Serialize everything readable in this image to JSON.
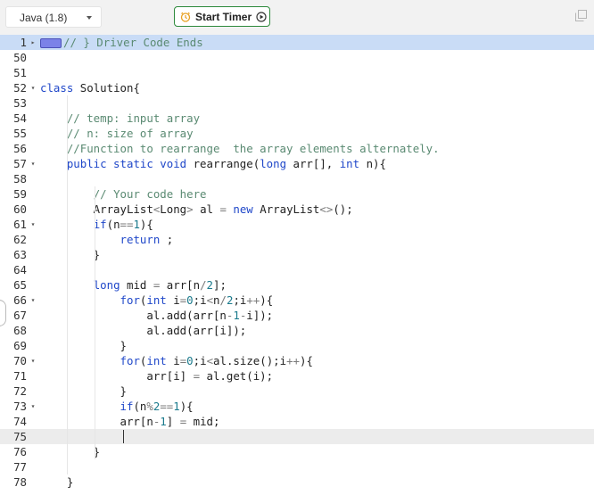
{
  "toolbar": {
    "language": "Java (1.8)",
    "timer_label": "Start Timer",
    "accent": "#2e8a3c"
  },
  "editor": {
    "lines": [
      {
        "num": "1",
        "fold": "right",
        "hl": "blue",
        "badge": true,
        "tokens": [
          [
            "c",
            "// } Driver Code Ends"
          ]
        ]
      },
      {
        "num": "50",
        "tokens": []
      },
      {
        "num": "51",
        "tokens": []
      },
      {
        "num": "52",
        "fold": "down",
        "tokens": [
          [
            "k",
            "class"
          ],
          [
            "t",
            " Solution{"
          ]
        ]
      },
      {
        "num": "53",
        "tokens": []
      },
      {
        "num": "54",
        "tokens": [
          [
            "t",
            "    "
          ],
          [
            "c",
            "// temp: input array"
          ]
        ]
      },
      {
        "num": "55",
        "tokens": [
          [
            "t",
            "    "
          ],
          [
            "c",
            "// n: size of array"
          ]
        ]
      },
      {
        "num": "56",
        "tokens": [
          [
            "t",
            "    "
          ],
          [
            "c",
            "//Function to rearrange  the array elements alternately."
          ]
        ]
      },
      {
        "num": "57",
        "fold": "down",
        "tokens": [
          [
            "t",
            "    "
          ],
          [
            "k",
            "public static void"
          ],
          [
            "t",
            " rearrange("
          ],
          [
            "k",
            "long"
          ],
          [
            "t",
            " arr[], "
          ],
          [
            "k",
            "int"
          ],
          [
            "t",
            " n){"
          ]
        ]
      },
      {
        "num": "58",
        "tokens": []
      },
      {
        "num": "59",
        "tokens": [
          [
            "t",
            "        "
          ],
          [
            "c",
            "// Your code here"
          ]
        ]
      },
      {
        "num": "60",
        "tokens": [
          [
            "t",
            "        ArrayList"
          ],
          [
            "o",
            "<"
          ],
          [
            "t",
            "Long"
          ],
          [
            "o",
            ">"
          ],
          [
            "t",
            " al "
          ],
          [
            "o",
            "="
          ],
          [
            "t",
            " "
          ],
          [
            "k",
            "new"
          ],
          [
            "t",
            " ArrayList"
          ],
          [
            "o",
            "<>"
          ],
          [
            "t",
            "();"
          ]
        ]
      },
      {
        "num": "61",
        "fold": "down",
        "tokens": [
          [
            "t",
            "        "
          ],
          [
            "k",
            "if"
          ],
          [
            "t",
            "(n"
          ],
          [
            "o",
            "=="
          ],
          [
            "n",
            "1"
          ],
          [
            "t",
            "){"
          ]
        ]
      },
      {
        "num": "62",
        "tokens": [
          [
            "t",
            "            "
          ],
          [
            "k",
            "return"
          ],
          [
            "t",
            " ;"
          ]
        ]
      },
      {
        "num": "63",
        "tokens": [
          [
            "t",
            "        }"
          ]
        ]
      },
      {
        "num": "64",
        "tokens": []
      },
      {
        "num": "65",
        "tokens": [
          [
            "t",
            "        "
          ],
          [
            "k",
            "long"
          ],
          [
            "t",
            " mid "
          ],
          [
            "o",
            "="
          ],
          [
            "t",
            " arr[n"
          ],
          [
            "o",
            "/"
          ],
          [
            "n",
            "2"
          ],
          [
            "t",
            "];"
          ]
        ]
      },
      {
        "num": "66",
        "fold": "down",
        "tokens": [
          [
            "t",
            "            "
          ],
          [
            "k",
            "for"
          ],
          [
            "t",
            "("
          ],
          [
            "k",
            "int"
          ],
          [
            "t",
            " i"
          ],
          [
            "o",
            "="
          ],
          [
            "n",
            "0"
          ],
          [
            "t",
            ";i"
          ],
          [
            "o",
            "<"
          ],
          [
            "t",
            "n"
          ],
          [
            "o",
            "/"
          ],
          [
            "n",
            "2"
          ],
          [
            "t",
            ";i"
          ],
          [
            "o",
            "++"
          ],
          [
            "t",
            "){"
          ]
        ]
      },
      {
        "num": "67",
        "tokens": [
          [
            "t",
            "                al.add(arr[n"
          ],
          [
            "o",
            "-"
          ],
          [
            "n",
            "1"
          ],
          [
            "o",
            "-"
          ],
          [
            "t",
            "i]);"
          ]
        ]
      },
      {
        "num": "68",
        "tokens": [
          [
            "t",
            "                al.add(arr[i]);"
          ]
        ]
      },
      {
        "num": "69",
        "tokens": [
          [
            "t",
            "            }"
          ]
        ]
      },
      {
        "num": "70",
        "fold": "down",
        "tokens": [
          [
            "t",
            "            "
          ],
          [
            "k",
            "for"
          ],
          [
            "t",
            "("
          ],
          [
            "k",
            "int"
          ],
          [
            "t",
            " i"
          ],
          [
            "o",
            "="
          ],
          [
            "n",
            "0"
          ],
          [
            "t",
            ";i"
          ],
          [
            "o",
            "<"
          ],
          [
            "t",
            "al.size();i"
          ],
          [
            "o",
            "++"
          ],
          [
            "t",
            "){"
          ]
        ]
      },
      {
        "num": "71",
        "tokens": [
          [
            "t",
            "                arr[i] "
          ],
          [
            "o",
            "="
          ],
          [
            "t",
            " al.get(i);"
          ]
        ]
      },
      {
        "num": "72",
        "tokens": [
          [
            "t",
            "            }"
          ]
        ]
      },
      {
        "num": "73",
        "fold": "down",
        "tokens": [
          [
            "t",
            "            "
          ],
          [
            "k",
            "if"
          ],
          [
            "t",
            "(n"
          ],
          [
            "o",
            "%"
          ],
          [
            "n",
            "2"
          ],
          [
            "o",
            "=="
          ],
          [
            "n",
            "1"
          ],
          [
            "t",
            "){"
          ]
        ]
      },
      {
        "num": "74",
        "tokens": [
          [
            "t",
            "            arr[n"
          ],
          [
            "o",
            "-"
          ],
          [
            "n",
            "1"
          ],
          [
            "t",
            "] "
          ],
          [
            "o",
            "="
          ],
          [
            "t",
            " mid;"
          ]
        ]
      },
      {
        "num": "75",
        "hl": "current",
        "cursor": true,
        "tokens": []
      },
      {
        "num": "76",
        "tokens": [
          [
            "t",
            "        }"
          ]
        ]
      },
      {
        "num": "77",
        "tokens": []
      },
      {
        "num": "78",
        "tokens": [
          [
            "t",
            "    }"
          ]
        ]
      }
    ]
  }
}
